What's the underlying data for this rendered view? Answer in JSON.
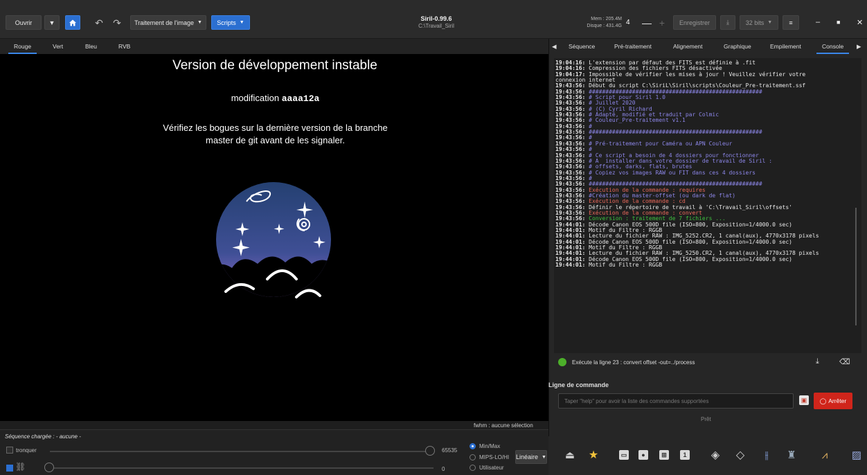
{
  "header": {
    "open_label": "Ouvrir",
    "processing_label": "Traitement de l'image",
    "scripts_label": "Scripts",
    "app_title": "Siril-0.99.6",
    "app_path": "C:\\Travail_Siril",
    "mem_label": "Mem : 205.4M",
    "disk_label": "Disque : 431.4G",
    "spin_value": "4",
    "save_label": "Enregistrer",
    "bits_label": "32 bits"
  },
  "channel_tabs": [
    "Rouge",
    "Vert",
    "Bleu",
    "RVB"
  ],
  "right_tabs": [
    "Séquence",
    "Pré-traitement",
    "Alignement",
    "Graphique",
    "Empilement",
    "Console"
  ],
  "view": {
    "title": "Version de développement instable",
    "mod_prefix": "modification ",
    "mod_hash": "aaaa12a",
    "warn_line1": "Vérifiez les bogues sur la dernière version de la branche",
    "warn_line2": "master de git avant de les signaler.",
    "fwhm": "fwhm : aucune sélection"
  },
  "bottom": {
    "sequence_label": "Séquence chargée : - aucune -",
    "truncate_label": "tronquer",
    "max_value": "65535",
    "min_value": "0",
    "radio_options": [
      "Min/Max",
      "MIPS-LO/HI",
      "Utilisateur"
    ],
    "scale_label": "Linéaire"
  },
  "console": {
    "lines": [
      {
        "t": "19:04:16:",
        "m": " L'extension par défaut des FITS est définie à .fit",
        "c": "white"
      },
      {
        "t": "19:04:16:",
        "m": " Compression des fichiers FITS désactivée",
        "c": "white"
      },
      {
        "t": "19:04:17:",
        "m": " Impossible de vérifier les mises à jour ! Veuillez vérifier votre",
        "c": "white"
      },
      {
        "t": "",
        "m": "connexion internet",
        "c": "white"
      },
      {
        "t": "19:43:56:",
        "m": " Début du script C:\\SiriL\\Siril\\scripts\\Couleur_Pre-traitement.ssf",
        "c": "white"
      },
      {
        "t": "19:43:56:",
        "m": " ####################################################",
        "c": "purple"
      },
      {
        "t": "19:43:56:",
        "m": " # Script pour Siril 1.0",
        "c": "purple"
      },
      {
        "t": "19:43:56:",
        "m": " # Juillet 2020",
        "c": "purple"
      },
      {
        "t": "19:43:56:",
        "m": " # (C) Cyril Richard",
        "c": "purple"
      },
      {
        "t": "19:43:56:",
        "m": " # Adapté, modifié et traduit par Colmic",
        "c": "purple"
      },
      {
        "t": "19:43:56:",
        "m": " # Couleur_Pre-traitement v1.1",
        "c": "purple"
      },
      {
        "t": "19:43:56:",
        "m": " #",
        "c": "purple"
      },
      {
        "t": "19:43:56:",
        "m": " ####################################################",
        "c": "purple"
      },
      {
        "t": "19:43:56:",
        "m": " #",
        "c": "purple"
      },
      {
        "t": "19:43:56:",
        "m": " # Pré-traitement pour Caméra ou APN Couleur",
        "c": "purple"
      },
      {
        "t": "19:43:56:",
        "m": " #",
        "c": "purple"
      },
      {
        "t": "19:43:56:",
        "m": " # Ce script a besoin de 4 dossiers pour fonctionner",
        "c": "purple"
      },
      {
        "t": "19:43:56:",
        "m": " # A  installer dans votre dossier de travail de Siril :",
        "c": "purple"
      },
      {
        "t": "19:43:56:",
        "m": " # offsets, darks, flats, brutes",
        "c": "purple"
      },
      {
        "t": "19:43:56:",
        "m": " # Copiez vos images RAW ou FIT dans ces 4 dossiers",
        "c": "purple"
      },
      {
        "t": "19:43:56:",
        "m": " #",
        "c": "purple"
      },
      {
        "t": "19:43:56:",
        "m": " ####################################################",
        "c": "purple"
      },
      {
        "t": "19:43:56:",
        "m": " Exécution de la commande : requires",
        "c": "red"
      },
      {
        "t": "19:43:56:",
        "m": " #Création du master-offset (ou dark de flat)",
        "c": "purple"
      },
      {
        "t": "19:43:56:",
        "m": " Exécution de la commande : cd",
        "c": "red"
      },
      {
        "t": "19:43:56:",
        "m": " Définir le répertoire de travail à 'C:\\Travail_Siril\\offsets'",
        "c": "white"
      },
      {
        "t": "19:43:56:",
        "m": " Exécution de la commande : convert",
        "c": "red"
      },
      {
        "t": "19:43:56:",
        "m": " Conversion : traitement de 7 fichiers ...",
        "c": "green"
      },
      {
        "t": "19:44:01:",
        "m": " Décode Canon EOS 500D file (ISO=800, Exposition=1/4000.0 sec)",
        "c": "white"
      },
      {
        "t": "19:44:01:",
        "m": " Motif du Filtre : RGGB",
        "c": "white"
      },
      {
        "t": "19:44:01:",
        "m": " Lecture du fichier RAW : IMG_5252.CR2, 1 canal(aux), 4770x3178 pixels",
        "c": "white"
      },
      {
        "t": "19:44:01:",
        "m": " Décode Canon EOS 500D file (ISO=800, Exposition=1/4000.0 sec)",
        "c": "white"
      },
      {
        "t": "19:44:01:",
        "m": " Motif du Filtre : RGGB",
        "c": "white"
      },
      {
        "t": "19:44:01:",
        "m": " Lecture du fichier RAW : IMG_5250.CR2, 1 canal(aux), 4770x3178 pixels",
        "c": "white"
      },
      {
        "t": "19:44:01:",
        "m": " Décode Canon EOS 500D file (ISO=800, Exposition=1/4000.0 sec)",
        "c": "white"
      },
      {
        "t": "19:44:01:",
        "m": " Motif du Filtre : RGGB",
        "c": "white"
      }
    ],
    "status_text": "Exécute la ligne 23 : convert offset -out=../process",
    "command_label": "Ligne de commande",
    "command_placeholder": "Taper \"help\" pour avoir la liste des commandes supportées",
    "stop_label": "Arrêter",
    "ready_label": "Prêt"
  },
  "colors": {
    "accent": "#2b6fd1",
    "stop": "#d0251b",
    "console_purple": "#8c86e8",
    "console_red": "#e8685a",
    "console_green": "#3fbf3f"
  }
}
